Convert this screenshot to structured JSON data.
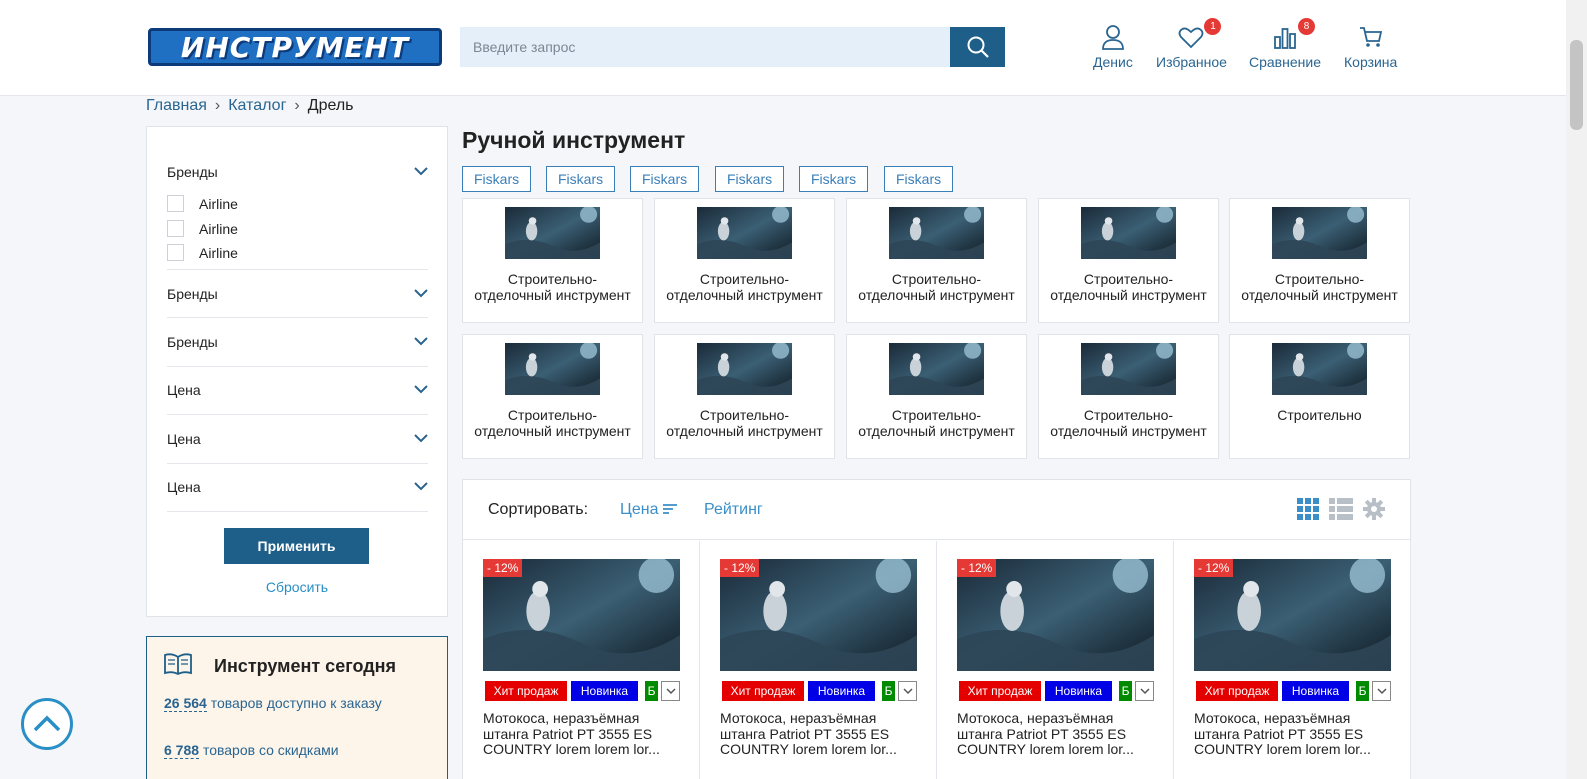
{
  "header": {
    "logo_text": "ИНСТРУМЕНТ",
    "search_placeholder": "Введите запрос",
    "account_label": "Денис",
    "favorites_label": "Избранное",
    "favorites_count": "1",
    "compare_label": "Сравнение",
    "compare_count": "8",
    "cart_label": "Корзина"
  },
  "breadcrumb": {
    "items": [
      "Главная",
      "Каталог"
    ],
    "current": "Дрель"
  },
  "filters": {
    "groups": [
      "Бренды",
      "Бренды",
      "Бренды",
      "Цена",
      "Цена",
      "Цена"
    ],
    "brand_options": [
      "Airline",
      "Airline",
      "Airline"
    ],
    "apply_label": "Применить",
    "reset_label": "Сбросить"
  },
  "today": {
    "title": "Инструмент сегодня",
    "available_num": "26 564",
    "available_text": "товаров доступно к заказу",
    "discount_num": "6 788",
    "discount_text": "товаров со скидками"
  },
  "main": {
    "title": "Ручной инструмент",
    "tags": [
      "Fiskars",
      "Fiskars",
      "Fiskars",
      "Fiskars",
      "Fiskars",
      "Fiskars"
    ],
    "categories": [
      "Строительно-отделочный инструмент",
      "Строительно-отделочный инструмент",
      "Строительно-отделочный инструмент",
      "Строительно-отделочный инструмент",
      "Строительно-отделочный инструмент",
      "Строительно-отделочный инструмент",
      "Строительно-отделочный инструмент",
      "Строительно-отделочный инструмент",
      "Строительно-отделочный инструмент",
      "Строительно"
    ]
  },
  "sort": {
    "label": "Сортировать:",
    "options": [
      "Цена",
      "Рейтинг"
    ]
  },
  "products": [
    {
      "discount": "- 12%",
      "labels": [
        "Хит продаж",
        "Новинка",
        "Б"
      ],
      "title": "Мотокоса, неразъёмная штанга Patriot PT 3555 ES COUNTRY lorem lorem lor..."
    },
    {
      "discount": "- 12%",
      "labels": [
        "Хит продаж",
        "Новинка",
        "Б"
      ],
      "title": "Мотокоса, неразъёмная штанга Patriot PT 3555 ES COUNTRY lorem lorem lor..."
    },
    {
      "discount": "- 12%",
      "labels": [
        "Хит продаж",
        "Новинка",
        "Б"
      ],
      "title": "Мотокоса, неразъёмная штанга Patriot PT 3555 ES COUNTRY lorem lorem lor..."
    },
    {
      "discount": "- 12%",
      "labels": [
        "Хит продаж",
        "Новинка",
        "Б"
      ],
      "title": "Мотокоса, неразъёмная штанга Patriot PT 3555 ES COUNTRY lorem lorem lor..."
    }
  ],
  "colors": {
    "primary": "#1e5f8a",
    "link": "#2a6591",
    "accent_blue": "#3a8fc8",
    "hit_label": "#e50000",
    "new_label": "#0000e6",
    "green_label": "#008a00",
    "badge": "#e53935"
  },
  "icons": {
    "search": "search-icon",
    "account": "user-icon",
    "favorites": "heart-icon",
    "compare": "bar-chart-icon",
    "cart": "cart-icon",
    "grid_view": "grid-icon",
    "list_view": "list-icon",
    "settings": "gear-icon",
    "scroll_up": "chevron-up-icon",
    "book": "book-icon"
  }
}
